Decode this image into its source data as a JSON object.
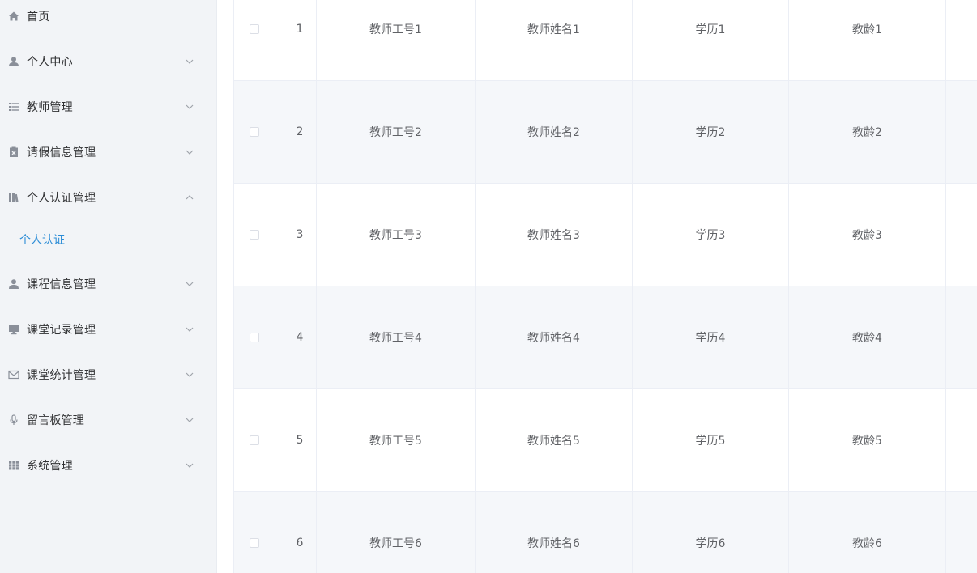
{
  "sidebar": {
    "items": [
      {
        "label": "首页",
        "icon": "home-icon"
      },
      {
        "label": "个人中心",
        "icon": "user-icon",
        "expandable": true
      },
      {
        "label": "教师管理",
        "icon": "list-icon",
        "expandable": true
      },
      {
        "label": "请假信息管理",
        "icon": "clipboard-icon",
        "expandable": true
      },
      {
        "label": "个人认证管理",
        "icon": "books-icon",
        "expandable": true,
        "expanded": true
      },
      {
        "label": "课程信息管理",
        "icon": "user-icon",
        "expandable": true
      },
      {
        "label": "课堂记录管理",
        "icon": "monitor-icon",
        "expandable": true
      },
      {
        "label": "课堂统计管理",
        "icon": "mail-icon",
        "expandable": true
      },
      {
        "label": "留言板管理",
        "icon": "microphone-icon",
        "expandable": true
      },
      {
        "label": "系统管理",
        "icon": "grid-icon",
        "expandable": true
      }
    ],
    "active_subitem": {
      "label": "个人认证",
      "parent": "个人认证管理"
    }
  },
  "colors": {
    "sidebar_bg": "#f2f4f7",
    "active_text": "#2b8cd6",
    "stripe_row": "#f5f7fa",
    "border": "#ebeef5"
  },
  "table": {
    "rows": [
      {
        "index": "1",
        "teacher_id": "教师工号1",
        "teacher_name": "教师姓名1",
        "education": "学历1",
        "teaching_years": "教龄1"
      },
      {
        "index": "2",
        "teacher_id": "教师工号2",
        "teacher_name": "教师姓名2",
        "education": "学历2",
        "teaching_years": "教龄2"
      },
      {
        "index": "3",
        "teacher_id": "教师工号3",
        "teacher_name": "教师姓名3",
        "education": "学历3",
        "teaching_years": "教龄3"
      },
      {
        "index": "4",
        "teacher_id": "教师工号4",
        "teacher_name": "教师姓名4",
        "education": "学历4",
        "teaching_years": "教龄4"
      },
      {
        "index": "5",
        "teacher_id": "教师工号5",
        "teacher_name": "教师姓名5",
        "education": "学历5",
        "teaching_years": "教龄5"
      },
      {
        "index": "6",
        "teacher_id": "教师工号6",
        "teacher_name": "教师姓名6",
        "education": "学历6",
        "teaching_years": "教龄6"
      }
    ]
  }
}
